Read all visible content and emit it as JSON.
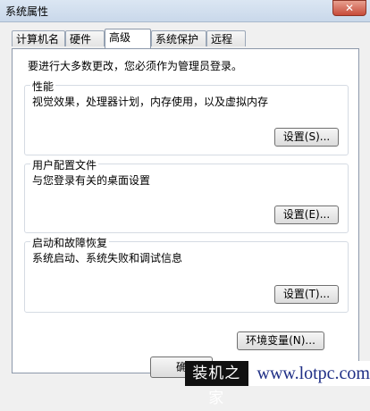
{
  "window": {
    "title": "系统属性",
    "close_label": "✕"
  },
  "tabs": [
    {
      "label": "计算机名"
    },
    {
      "label": "硬件"
    },
    {
      "label": "高级"
    },
    {
      "label": "系统保护"
    },
    {
      "label": "远程"
    }
  ],
  "notice": "要进行大多数更改，您必须作为管理员登录。",
  "groups": {
    "performance": {
      "title": "性能",
      "desc": "视觉效果，处理器计划，内存使用，以及虚拟内存",
      "button": "设置(S)..."
    },
    "profile": {
      "title": "用户配置文件",
      "desc": "与您登录有关的桌面设置",
      "button": "设置(E)..."
    },
    "startup": {
      "title": "启动和故障恢复",
      "desc": "系统启动、系统失败和调试信息",
      "button": "设置(T)..."
    }
  },
  "env_button": "环境变量(N)...",
  "footer": {
    "ok_label": "确"
  },
  "watermark": {
    "logo": "装机之家",
    "url": "www.lotpc.com"
  }
}
